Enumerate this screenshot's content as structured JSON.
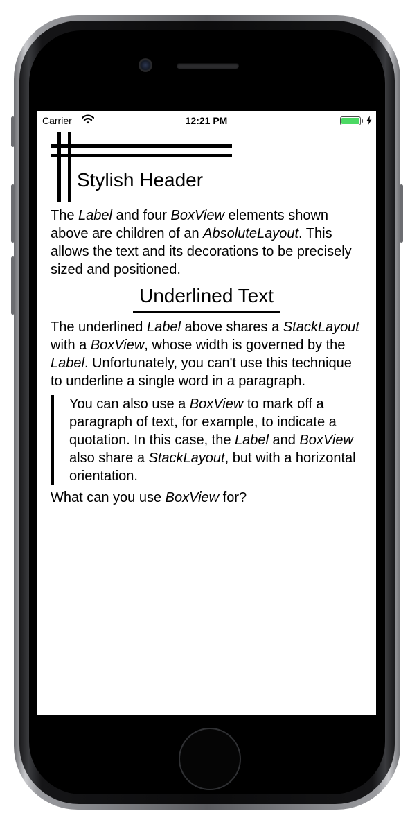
{
  "status_bar": {
    "carrier": "Carrier",
    "time": "12:21 PM",
    "battery_color": "#4cd964"
  },
  "header": {
    "title": "Stylish Header"
  },
  "paragraph1": {
    "t1": "The ",
    "e1": "Label",
    "t2": " and four ",
    "e2": "BoxView",
    "t3": " elements shown above are children of an ",
    "e3": "AbsoluteLayout",
    "t4": ". This allows the text and its decorations to be precisely sized and positioned."
  },
  "underlined": {
    "title": "Underlined Text"
  },
  "paragraph2": {
    "t1": "The underlined ",
    "e1": "Label",
    "t2": " above shares a ",
    "e2": "StackLayout",
    "t3": " with a ",
    "e3": "BoxView",
    "t4": ", whose width is governed by the ",
    "e4": "Label",
    "t5": ". Unfortunately, you can't use this technique to underline a single word in a paragraph."
  },
  "quote": {
    "t1": "You can also use a ",
    "e1": "BoxView",
    "t2": " to mark off a paragraph of text, for example, to indicate a quotation. In this case, the ",
    "e2": "Label",
    "t3": " and ",
    "e3": "BoxView",
    "t4": " also share a ",
    "e4": "StackLayout",
    "t5": ", but with a horizontal orientation."
  },
  "paragraph3": {
    "t1": "What can you use ",
    "e1": "BoxView",
    "t2": " for?"
  }
}
